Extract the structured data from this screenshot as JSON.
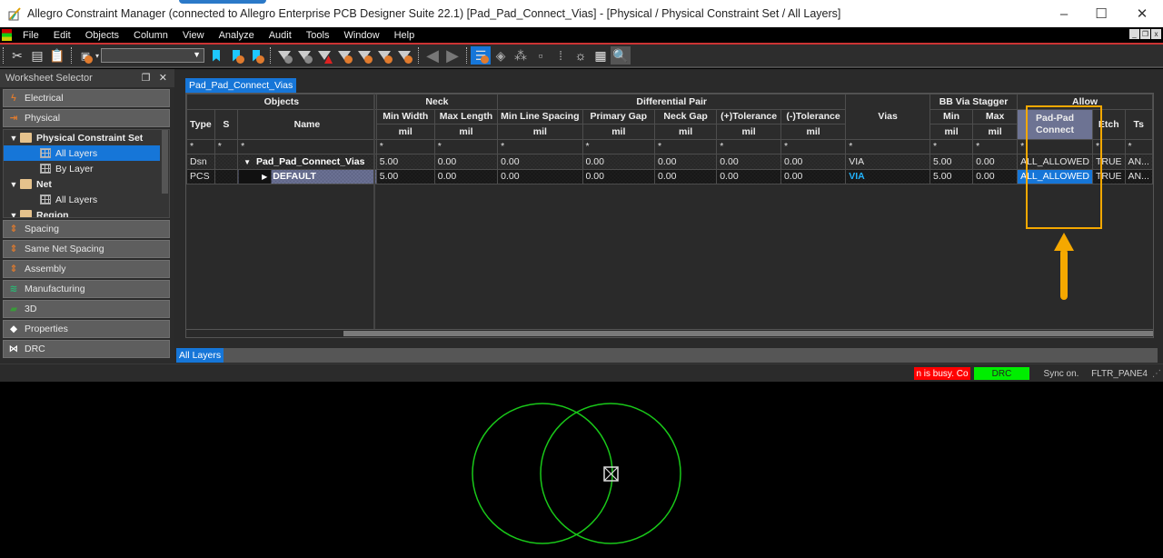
{
  "window": {
    "title": "Allegro Constraint Manager (connected to Allegro Enterprise PCB Designer Suite 22.1) [Pad_Pad_Connect_Vias] - [Physical / Physical Constraint Set / All Layers]",
    "controls": {
      "minimize": "–",
      "maximize": "☐",
      "close": "✕"
    }
  },
  "menu": [
    "File",
    "Edit",
    "Objects",
    "Column",
    "View",
    "Analyze",
    "Audit",
    "Tools",
    "Window",
    "Help"
  ],
  "toolbar": {
    "combo_value": "",
    "icons": [
      "cut-icon",
      "copy-icon",
      "paste-icon",
      "find-icon",
      "bookmark-icon",
      "next-bookmark-icon",
      "previous-bookmark-icon",
      "filter-undo-icon",
      "filter-copy-icon",
      "filter-error-icon",
      "filter-select-icon",
      "filter-settings-icon",
      "filter-list-icon",
      "filter-columns-icon",
      "undo-icon",
      "redo-icon",
      "worksheet-icon",
      "tag-icon",
      "tree-icon",
      "object-icon",
      "group-icon",
      "light-icon",
      "report-icon",
      "zoom-icon"
    ]
  },
  "worksheet_selector": {
    "title": "Worksheet Selector",
    "categories_top": [
      {
        "label": "Electrical",
        "icon": "lightning-icon"
      },
      {
        "label": "Physical",
        "icon": "physical-icon"
      }
    ],
    "tree": [
      {
        "label": "Physical Constraint Set",
        "type": "folder",
        "level": 0,
        "expanded": true
      },
      {
        "label": "All Layers",
        "type": "worksheet",
        "level": 1,
        "selected": true
      },
      {
        "label": "By Layer",
        "type": "worksheet",
        "level": 1
      },
      {
        "label": "Net",
        "type": "folder",
        "level": 0,
        "expanded": true
      },
      {
        "label": "All Layers",
        "type": "worksheet",
        "level": 1
      },
      {
        "label": "Region",
        "type": "folder",
        "level": 0,
        "expanded": true
      }
    ],
    "categories_bottom": [
      {
        "label": "Spacing",
        "icon": "spacing-icon"
      },
      {
        "label": "Same Net Spacing",
        "icon": "same-net-spacing-icon"
      },
      {
        "label": "Assembly",
        "icon": "assembly-icon"
      },
      {
        "label": "Manufacturing",
        "icon": "manufacturing-icon"
      },
      {
        "label": "3D",
        "icon": "3d-icon"
      },
      {
        "label": "Properties",
        "icon": "tag-icon"
      },
      {
        "label": "DRC",
        "icon": "drc-icon"
      }
    ]
  },
  "document_tab": "Pad_Pad_Connect_Vias",
  "grid": {
    "group_headers": {
      "objects": "Objects",
      "neck": "Neck",
      "diff_pair": "Differential Pair",
      "vias": "Vias",
      "bb_via_stagger": "BB Via Stagger",
      "allow": "Allow"
    },
    "columns": {
      "type": "Type",
      "s": "S",
      "name": "Name",
      "min_width": "Min Width",
      "max_length": "Max Length",
      "min_line_spacing": "Min Line Spacing",
      "primary_gap": "Primary Gap",
      "neck_gap": "Neck Gap",
      "plus_tol": "(+)Tolerance",
      "minus_tol": "(-)Tolerance",
      "bb_min": "Min",
      "bb_max": "Max",
      "pad_pad_connect": "Pad-Pad Connect",
      "etch": "Etch",
      "ts": "Ts"
    },
    "unit": "mil",
    "filter": "*",
    "rows": [
      {
        "type": "Dsn",
        "s": "",
        "name": "Pad_Pad_Connect_Vias",
        "expander": "▼",
        "min_width": "5.00",
        "max_length": "0.00",
        "min_line_spacing": "0.00",
        "primary_gap": "0.00",
        "neck_gap": "0.00",
        "plus_tol": "0.00",
        "minus_tol": "0.00",
        "vias": "VIA",
        "bb_min": "5.00",
        "bb_max": "0.00",
        "pad_pad_connect": "ALL_ALLOWED",
        "etch": "TRUE",
        "ts": "AN..."
      },
      {
        "type": "PCS",
        "s": "",
        "name": "DEFAULT",
        "expander": "▶",
        "min_width": "5.00",
        "max_length": "0.00",
        "min_line_spacing": "0.00",
        "primary_gap": "0.00",
        "neck_gap": "0.00",
        "plus_tol": "0.00",
        "minus_tol": "0.00",
        "vias": "VIA",
        "bb_min": "5.00",
        "bb_max": "0.00",
        "pad_pad_connect": "ALL_ALLOWED",
        "etch": "TRUE",
        "ts": "AN..."
      }
    ]
  },
  "bottom_tab": "All Layers",
  "status": {
    "busy": "n is busy. Co",
    "drc": "DRC",
    "sync": "Sync on.",
    "pane": "FLTR_PANE4"
  },
  "colors": {
    "selection": "#1676d8",
    "highlight_box": "#f5a800",
    "via_circle": "#19c819",
    "status_busy": "#ff0000",
    "status_drc": "#00ee00"
  }
}
